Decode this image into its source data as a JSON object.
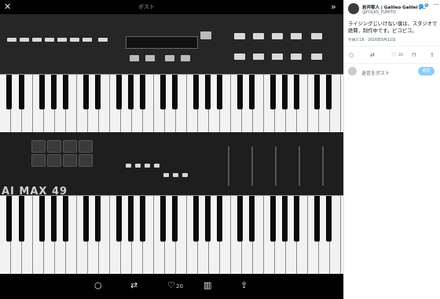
{
  "viewer": {
    "icons": {
      "close": "close-icon",
      "collapse": "chevron-double-right-icon",
      "reply": "reply-icon",
      "retweet": "retweet-icon",
      "like": "heart-icon",
      "views": "bar-chart-icon",
      "share": "share-icon"
    },
    "like_count": "20",
    "keyboard_brand": "AI MAX 49",
    "caption_top": "ポスト"
  },
  "post": {
    "author_name": "岩井郁人 | Galileo Galilei j...",
    "handle": "@FOLKS_FUMITO",
    "text": "ライジングじいけない僕は、スタジオで絶賛、制作中です。ピコピコ。",
    "timestamp": "午後3:18 · 2016年8月12日",
    "like_count": "20",
    "reply_placeholder": "返信をポスト",
    "reply_button": "返信"
  },
  "colors": {
    "accent": "#1d9bf0",
    "reply_button_disabled": "#8ecdf8",
    "text_primary": "#0f1419",
    "text_secondary": "#536471"
  }
}
